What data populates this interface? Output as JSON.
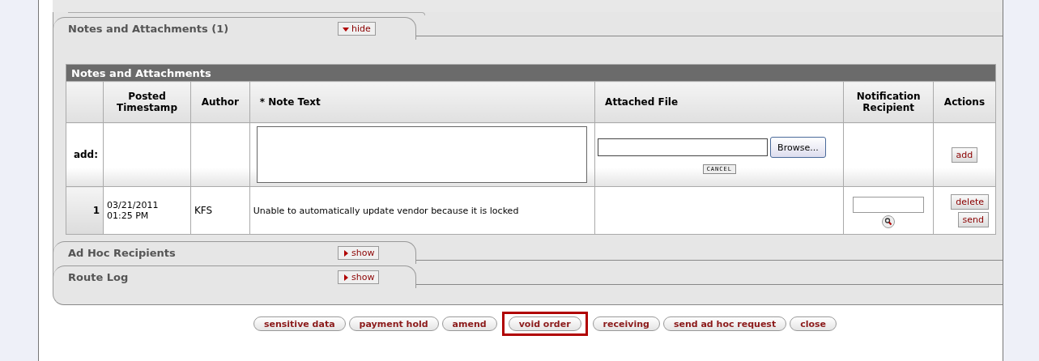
{
  "tabs": [
    {
      "title": "Notes and Attachments (1)",
      "toggle": "hide",
      "expanded": true
    },
    {
      "title": "Ad Hoc Recipients",
      "toggle": "show",
      "expanded": false
    },
    {
      "title": "Route Log",
      "toggle": "show",
      "expanded": false
    }
  ],
  "notes_table": {
    "title": "Notes and Attachments",
    "columns": [
      "Posted Timestamp",
      "Author",
      "* Note Text",
      "Attached File",
      "Notification Recipient",
      "Actions"
    ],
    "add_row": {
      "label": "add:",
      "browse_button": "Browse...",
      "cancel_button": "CANCEL",
      "add_button": "add"
    },
    "rows": [
      {
        "number": "1",
        "timestamp": "03/21/2011 01:25 PM",
        "author": "KFS",
        "note": "Unable to automatically update vendor because it is locked",
        "actions": [
          "delete",
          "send"
        ]
      }
    ]
  },
  "buttons": [
    {
      "label": "sensitive data",
      "highlighted": false
    },
    {
      "label": "payment hold",
      "highlighted": false
    },
    {
      "label": "amend",
      "highlighted": false
    },
    {
      "label": "void order",
      "highlighted": true
    },
    {
      "label": "receiving",
      "highlighted": false
    },
    {
      "label": "send ad hoc request",
      "highlighted": false
    },
    {
      "label": "close",
      "highlighted": false
    }
  ]
}
